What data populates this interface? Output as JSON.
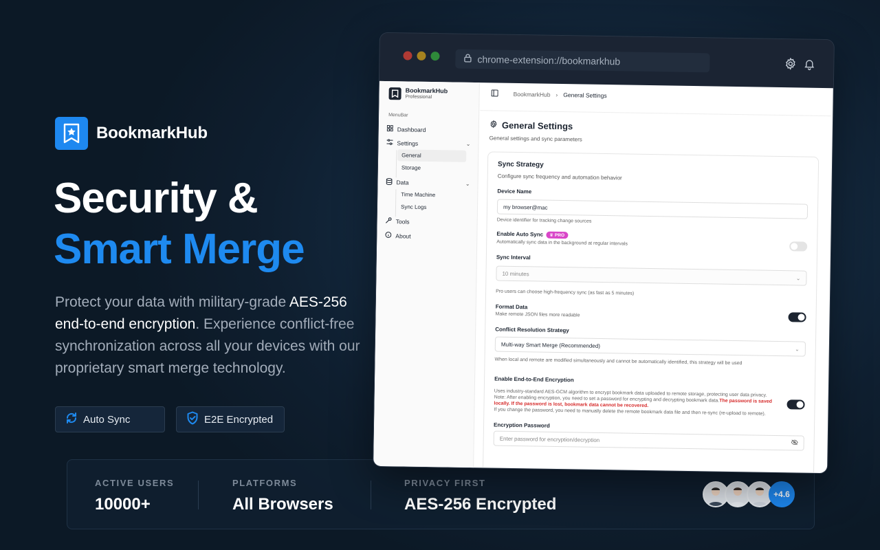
{
  "brand": {
    "name": "BookmarkHub",
    "logo_icon": "bookmark-star-icon",
    "color": "#1e88f0"
  },
  "hero": {
    "title_line1": "Security &",
    "title_line2": "Smart Merge",
    "desc_part1": "Protect your data with military-grade ",
    "desc_bold1": "AES-256 end-to-end encryption",
    "desc_part2": ". Experience conflict-free synchronization across all your devices with our proprietary smart merge technology."
  },
  "features": [
    {
      "label": "Auto Sync",
      "icon": "sync-icon"
    },
    {
      "label": "E2E Encrypted",
      "icon": "shield-check-icon"
    }
  ],
  "stats": [
    {
      "label": "ACTIVE USERS",
      "value": "10000+"
    },
    {
      "label": "PLATFORMS",
      "value": "All Browsers"
    },
    {
      "label": "PRIVACY FIRST",
      "value": "AES-256 Encrypted"
    }
  ],
  "rating_badge": "+4.6",
  "browser": {
    "url": "chrome-extension://bookmarkhub"
  },
  "sidebar": {
    "brand_name": "BookmarkHub",
    "brand_sub": "Professional",
    "section": "MenuBar",
    "items": {
      "dashboard": "Dashboard",
      "settings": "Settings",
      "general": "General",
      "storage": "Storage",
      "data": "Data",
      "time_machine": "Time Machine",
      "sync_logs": "Sync Logs",
      "tools": "Tools",
      "about": "About"
    }
  },
  "breadcrumb": {
    "root": "BookmarkHub",
    "current": "General Settings"
  },
  "page": {
    "title": "General Settings",
    "subtitle": "General settings and sync parameters"
  },
  "card": {
    "title": "Sync Strategy",
    "subtitle": "Configure sync frequency and automation behavior",
    "device_name_label": "Device Name",
    "device_name_value": "my browser@mac",
    "device_name_hint": "Device identifier for tracking change sources",
    "auto_sync_label": "Enable Auto Sync",
    "pro_badge": "PRO",
    "auto_sync_hint": "Automatically sync data in the background at regular intervals",
    "sync_interval_label": "Sync Interval",
    "sync_interval_value": "10 minutes",
    "sync_interval_hint": "Pro users can choose high-frequency sync (as fast as 5 minutes)",
    "format_label": "Format Data",
    "format_hint": "Make remote JSON files more readable",
    "conflict_label": "Conflict Resolution Strategy",
    "conflict_value": "Multi-way Smart Merge (Recommended)",
    "conflict_hint": "When local and remote are modified simultaneously and cannot be automatically identified, this strategy will be used",
    "e2e_label": "Enable End-to-End Encryption",
    "e2e_hint1": "Uses industry-standard AES-GCM algorithm to encrypt bookmark data uploaded to remote storage, protecting user data privacy.",
    "e2e_hint2": "Note: After enabling encryption, you need to set a password for encrypting and decrypting bookmark data.",
    "e2e_warn": "The password is saved locally. If the password is lost, bookmark data cannot be recovered.",
    "e2e_hint3": "If you change the password, you need to manually delete the remote bookmark data file and then re-sync (re-upload to remote).",
    "password_label": "Encryption Password",
    "password_placeholder": "Enter password for encryption/decryption"
  }
}
